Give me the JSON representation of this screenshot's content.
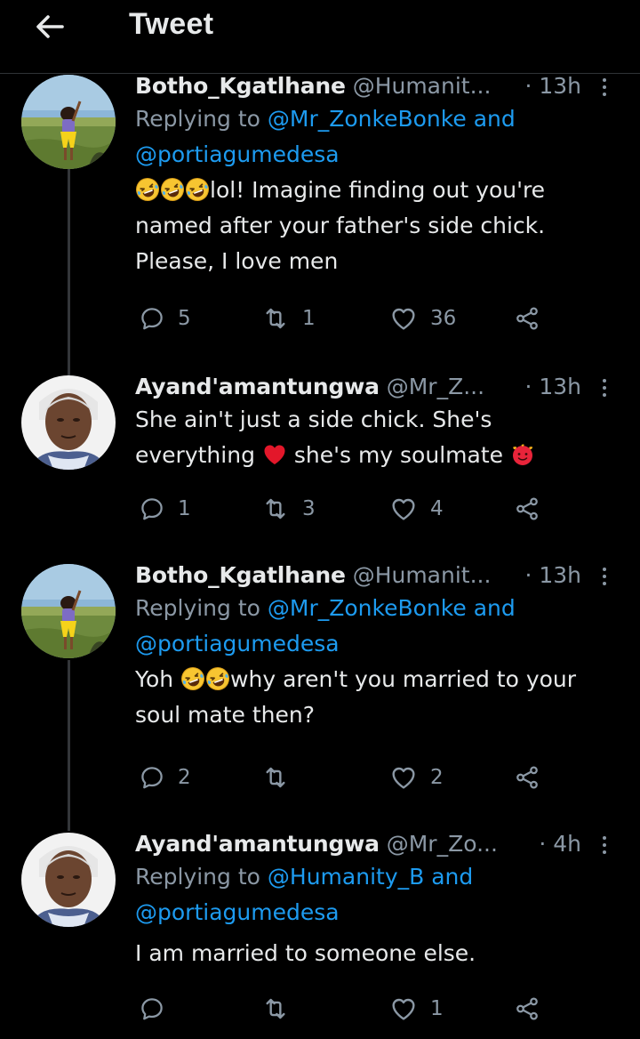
{
  "header": {
    "title": "Tweet",
    "back_icon": "arrow-left-icon"
  },
  "tweets": [
    {
      "name": "Botho_Kgatlhane",
      "handle": "@Humanit...",
      "time": "· 13h",
      "replying_prefix": "Replying to",
      "replying_to_1": "@Mr_ZonkeBonke",
      "replying_and": "and",
      "replying_to_2": "@portiagumedesa",
      "text_1": "lol! Imagine finding out you're",
      "text_2": "named after your father's side chick.",
      "text_3": "Please, I love men",
      "replies": "5",
      "retweets": "1",
      "likes": "36"
    },
    {
      "name": "Ayand'amantungwa",
      "handle": "@Mr_Z...",
      "time": "· 13h",
      "text_1": "She ain't just a side chick. She's",
      "text_2a": "everything",
      "text_2b": "she's my soulmate",
      "replies": "1",
      "retweets": "3",
      "likes": "4"
    },
    {
      "name": "Botho_Kgatlhane",
      "handle": "@Humanit...",
      "time": "· 13h",
      "replying_prefix": "Replying to",
      "replying_to_1": "@Mr_ZonkeBonke",
      "replying_and": "and",
      "replying_to_2": "@portiagumedesa",
      "text_1a": "Yoh",
      "text_1b": "why aren't you married to your",
      "text_2": "soul mate then?",
      "replies": "2",
      "retweets": "",
      "likes": "2"
    },
    {
      "name": "Ayand'amantungwa",
      "handle": "@Mr_Zo...",
      "time": "· 4h",
      "replying_prefix": "Replying to",
      "replying_to_1": "@Humanity_B",
      "replying_and": "and",
      "replying_to_2": "@portiagumedesa",
      "text_1": "I am married to someone else.",
      "replies": "",
      "retweets": "",
      "likes": "1"
    }
  ],
  "icons": {
    "reply": "reply-icon",
    "retweet": "retweet-icon",
    "like": "heart-outline-icon",
    "share": "share-icon",
    "more": "more-vertical-icon",
    "laugh": "rolling-laughing-emoji",
    "heart": "red-heart-emoji",
    "love_face": "smiling-face-with-hearts-emoji"
  },
  "colors": {
    "background": "#000000",
    "link": "#1d9bf0",
    "muted": "#8b98a5",
    "text": "#e7e9ea"
  }
}
